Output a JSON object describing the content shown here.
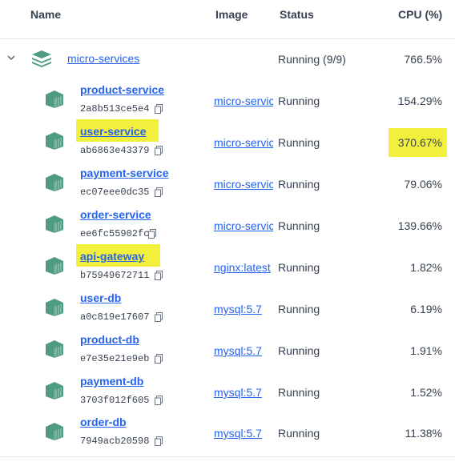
{
  "header": {
    "name": "Name",
    "image": "Image",
    "status": "Status",
    "cpu": "CPU (%)"
  },
  "group": {
    "name": "micro-services",
    "status": "Running (9/9)",
    "cpu": "766.5%"
  },
  "containers": [
    {
      "name": "product-service",
      "id": "2a8b513ce5e4",
      "image": "micro-services",
      "status": "Running",
      "cpu": "154.29%"
    },
    {
      "name": "user-service",
      "id": "ab6863e43379",
      "image": "micro-services",
      "status": "Running",
      "cpu": "370.67%"
    },
    {
      "name": "payment-service",
      "id": "ec07eee0dc35",
      "image": "micro-services",
      "status": "Running",
      "cpu": "79.06%"
    },
    {
      "name": "order-service",
      "id": "ee6fc55902fc",
      "image": "micro-services",
      "status": "Running",
      "cpu": "139.66%"
    },
    {
      "name": "api-gateway",
      "id": "b75949672711",
      "image": "nginx:latest",
      "status": "Running",
      "cpu": "1.82%"
    },
    {
      "name": "user-db",
      "id": "a0c819e17607",
      "image": "mysql:5.7",
      "status": "Running",
      "cpu": "6.19%"
    },
    {
      "name": "product-db",
      "id": "e7e35e21e9eb",
      "image": "mysql:5.7",
      "status": "Running",
      "cpu": "1.91%"
    },
    {
      "name": "payment-db",
      "id": "3703f012f605",
      "image": "mysql:5.7",
      "status": "Running",
      "cpu": "1.52%"
    },
    {
      "name": "order-db",
      "id": "7949acb20598",
      "image": "mysql:5.7",
      "status": "Running",
      "cpu": "11.38%"
    }
  ],
  "colors": {
    "accent": "#2563eb",
    "icon": "#4f9c82",
    "highlight": "#f3f03d"
  },
  "icons": {
    "group": "stack-icon",
    "container": "container-icon",
    "copy": "copy-icon",
    "expand": "chevron-down-icon"
  }
}
